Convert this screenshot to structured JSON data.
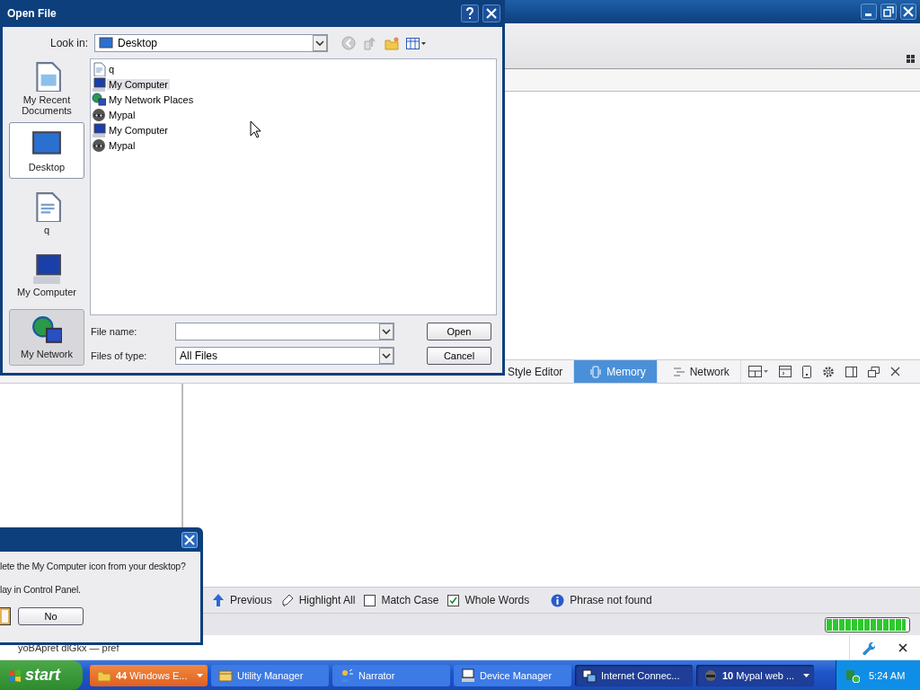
{
  "browser": {
    "devtools": {
      "tabs": [
        {
          "label": "Style Editor",
          "selected": false
        },
        {
          "label": "Memory",
          "selected": true
        },
        {
          "label": "Network",
          "selected": false
        }
      ]
    },
    "find_bar": {
      "items": [
        {
          "kind": "previous",
          "label": "Previous"
        },
        {
          "kind": "highlight",
          "label": "Highlight All"
        },
        {
          "kind": "checkbox",
          "label": "Match Case",
          "checked": false
        },
        {
          "kind": "checkbox",
          "label": "Whole Words",
          "checked": true
        },
        {
          "kind": "info",
          "label": "Phrase not found"
        }
      ]
    },
    "status_bar": {
      "progress": {
        "level": 0.97
      }
    },
    "notification_bar": {
      "message": "yoBApret dlGkx — pref"
    }
  },
  "open_dialog": {
    "title": "Open File",
    "look_in_label": "Look in:",
    "look_in_value": "Desktop",
    "places": [
      {
        "kind": "recent",
        "label": "My Recent Documents",
        "selected": false,
        "hovered": false
      },
      {
        "kind": "desktop",
        "label": "Desktop",
        "selected": true,
        "hovered": false
      },
      {
        "kind": "document",
        "label": "q",
        "selected": false,
        "hovered": false
      },
      {
        "kind": "computer",
        "label": "My Computer",
        "selected": false,
        "hovered": false
      },
      {
        "kind": "network",
        "label": "My Network",
        "selected": false,
        "hovered": true
      }
    ],
    "files": [
      {
        "kind": "document",
        "name": "q",
        "selected": false
      },
      {
        "kind": "computer",
        "name": "My Computer",
        "selected": true
      },
      {
        "kind": "network",
        "name": "My Network Places",
        "selected": false
      },
      {
        "kind": "app",
        "name": "Mypal",
        "selected": false
      },
      {
        "kind": "computer",
        "name": "My Computer",
        "selected": false
      },
      {
        "kind": "app",
        "name": "Mypal",
        "selected": false
      }
    ],
    "file_name_label": "File name:",
    "file_type_label": "Files of type:",
    "file_type_value": "All Files",
    "buttons": [
      "Open",
      "Cancel"
    ]
  },
  "confirm_dialog": {
    "lines": [
      "lete the My Computer icon from your desktop?",
      "lay in Control Panel."
    ],
    "buttons": [
      "No"
    ]
  },
  "taskbar": {
    "start": "start",
    "tasks": [
      {
        "kind": "folder",
        "count": "44",
        "label": "Windows E...",
        "flashing": true,
        "active": false,
        "menu": true
      },
      {
        "kind": "utility",
        "label": "Utility Manager",
        "flashing": false,
        "active": false,
        "menu": false
      },
      {
        "kind": "narrator",
        "label": "Narrator",
        "flashing": false,
        "active": false,
        "menu": false
      },
      {
        "kind": "device",
        "label": "Device Manager",
        "flashing": false,
        "active": false,
        "menu": false
      },
      {
        "kind": "network",
        "label": "Internet Connec...",
        "flashing": false,
        "active": true,
        "menu": false
      },
      {
        "kind": "browser",
        "count": "10",
        "label": "Mypal web ...",
        "flashing": false,
        "active": true,
        "menu": true
      }
    ],
    "clock": "5:24 AM"
  }
}
